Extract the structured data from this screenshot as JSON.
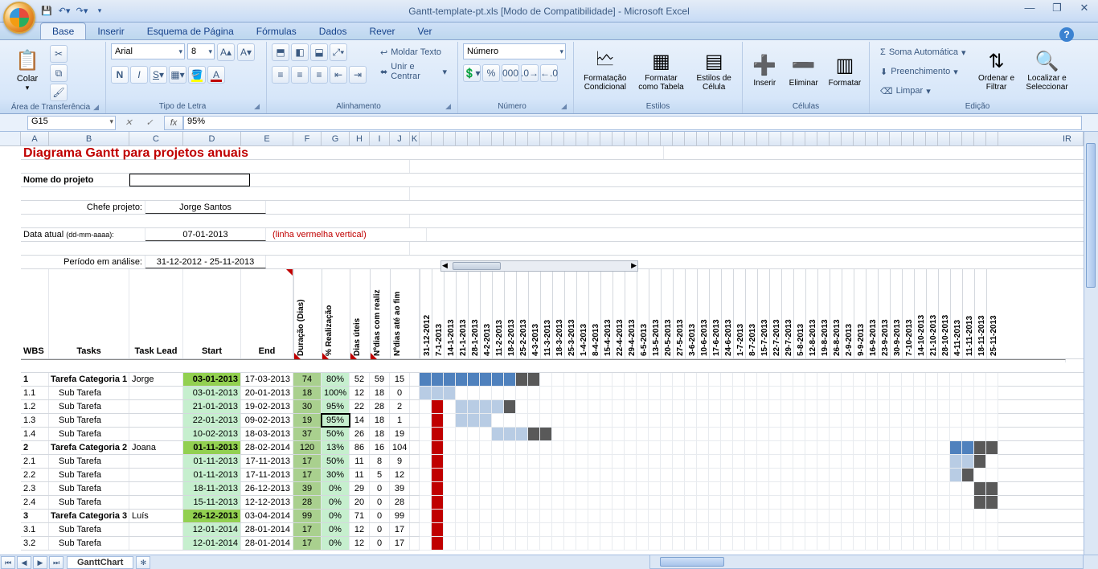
{
  "app": {
    "title": "Gantt-template-pt.xls  [Modo de Compatibilidade] - Microsoft Excel"
  },
  "qat": {
    "save": "save-icon",
    "undo": "undo-icon",
    "redo": "redo-icon"
  },
  "tabs": [
    "Base",
    "Inserir",
    "Esquema de Página",
    "Fórmulas",
    "Dados",
    "Rever",
    "Ver"
  ],
  "ribbon": {
    "clipboard": {
      "paste": "Colar",
      "label": "Área de Transferência"
    },
    "font": {
      "name": "Arial",
      "size": "8",
      "label": "Tipo de Letra"
    },
    "alignment": {
      "wrap": "Moldar Texto",
      "merge": "Unir e Centrar",
      "label": "Alinhamento"
    },
    "number": {
      "format": "Número",
      "label": "Número"
    },
    "styles": {
      "cond": "Formatação Condicional",
      "table": "Formatar como Tabela",
      "cell": "Estilos de Célula",
      "label": "Estilos"
    },
    "cells": {
      "insert": "Inserir",
      "delete": "Eliminar",
      "format": "Formatar",
      "label": "Células"
    },
    "editing": {
      "sum": "Soma Automática",
      "fill": "Preenchimento",
      "clear": "Limpar",
      "sort": "Ordenar e Filtrar",
      "find": "Localizar e Seleccionar",
      "label": "Edição"
    }
  },
  "namebox": "G15",
  "formula": "95%",
  "colHeaders": [
    "A",
    "B",
    "C",
    "D",
    "E",
    "F",
    "G",
    "H",
    "I",
    "J",
    "K"
  ],
  "lastCol": "IR",
  "content": {
    "title": "Diagrama Gantt para projetos anuais",
    "projLabel": "Nome do projeto",
    "pmLabel": "Chefe projeto:",
    "pmName": "Jorge Santos",
    "dateLabel": "Data atual",
    "dateFmt": "(dd-mm-aaaa):",
    "dateVal": "07-01-2013",
    "dateHint": "(linha vermelha vertical)",
    "periodLabel": "Período em análise:",
    "periodVal": "31-12-2012 - 25-11-2013",
    "hdr": {
      "wbs": "WBS",
      "tasks": "Tasks",
      "lead": "Task Lead",
      "start": "Start",
      "end": "End",
      "dur": "Duração (Dias)",
      "pct": "% Realização",
      "util": "Dias úteis",
      "real": "Nºdias com realiz",
      "fim": "Nºdias até ao fim"
    },
    "dates": [
      "31-12-2012",
      "7-1-2013",
      "14-1-2013",
      "21-1-2013",
      "28-1-2013",
      "4-2-2013",
      "11-2-2013",
      "18-2-2013",
      "25-2-2013",
      "4-3-2013",
      "11-3-2013",
      "18-3-2013",
      "25-3-2013",
      "1-4-2013",
      "8-4-2013",
      "15-4-2013",
      "22-4-2013",
      "29-4-2013",
      "6-5-2013",
      "13-5-2013",
      "20-5-2013",
      "27-5-2013",
      "3-6-2013",
      "10-6-2013",
      "17-6-2013",
      "24-6-2013",
      "1-7-2013",
      "8-7-2013",
      "15-7-2013",
      "22-7-2013",
      "29-7-2013",
      "5-8-2013",
      "12-8-2013",
      "19-8-2013",
      "26-8-2013",
      "2-9-2013",
      "9-9-2013",
      "16-9-2013",
      "23-9-2013",
      "30-9-2013",
      "7-10-2013",
      "14-10-2013",
      "21-10-2013",
      "28-10-2013",
      "4-11-2013",
      "11-11-2013",
      "18-11-2013",
      "25-11-2013"
    ]
  },
  "rows": [
    {
      "r": 12,
      "wbs": "1",
      "task": "Tarefa Categoria 1",
      "lead": "Jorge",
      "start": "03-01-2013",
      "end": "17-03-2013",
      "dur": "74",
      "pct": "80%",
      "u": "52",
      "nr": "59",
      "nf": "15",
      "cat": true,
      "bar": {
        "from": 0,
        "blue": 8,
        "dark": 2
      }
    },
    {
      "r": 13,
      "wbs": "1.1",
      "task": "Sub Tarefa",
      "lead": "",
      "start": "03-01-2013",
      "end": "20-01-2013",
      "dur": "18",
      "pct": "100%",
      "u": "12",
      "nr": "18",
      "nf": "0",
      "bar": {
        "from": 0,
        "light": 3
      }
    },
    {
      "r": 14,
      "wbs": "1.2",
      "task": "Sub Tarefa",
      "lead": "",
      "start": "21-01-2013",
      "end": "19-02-2013",
      "dur": "30",
      "pct": "95%",
      "u": "22",
      "nr": "28",
      "nf": "2",
      "bar": {
        "from": 3,
        "light": 4,
        "dark": 1
      }
    },
    {
      "r": 15,
      "wbs": "1.3",
      "task": "Sub Tarefa",
      "lead": "",
      "start": "22-01-2013",
      "end": "09-02-2013",
      "dur": "19",
      "pct": "95%",
      "u": "14",
      "nr": "18",
      "nf": "1",
      "sel": true,
      "bar": {
        "from": 3,
        "light": 3
      }
    },
    {
      "r": 16,
      "wbs": "1.4",
      "task": "Sub Tarefa",
      "lead": "",
      "start": "10-02-2013",
      "end": "18-03-2013",
      "dur": "37",
      "pct": "50%",
      "u": "26",
      "nr": "18",
      "nf": "19",
      "bar": {
        "from": 6,
        "light": 3,
        "dark": 2
      }
    },
    {
      "r": 17,
      "wbs": "2",
      "task": "Tarefa Categoria 2",
      "lead": "Joana",
      "start": "01-11-2013",
      "end": "28-02-2014",
      "dur": "120",
      "pct": "13%",
      "u": "86",
      "nr": "16",
      "nf": "104",
      "cat": true,
      "bar": {
        "from": 44,
        "blue": 2,
        "dark": 2
      }
    },
    {
      "r": 18,
      "wbs": "2.1",
      "task": "Sub Tarefa",
      "lead": "",
      "start": "01-11-2013",
      "end": "17-11-2013",
      "dur": "17",
      "pct": "50%",
      "u": "11",
      "nr": "8",
      "nf": "9",
      "bar": {
        "from": 44,
        "light": 2,
        "dark": 1
      }
    },
    {
      "r": 19,
      "wbs": "2.2",
      "task": "Sub Tarefa",
      "lead": "",
      "start": "01-11-2013",
      "end": "17-11-2013",
      "dur": "17",
      "pct": "30%",
      "u": "11",
      "nr": "5",
      "nf": "12",
      "bar": {
        "from": 44,
        "light": 1,
        "dark": 1
      }
    },
    {
      "r": 20,
      "wbs": "2.3",
      "task": "Sub Tarefa",
      "lead": "",
      "start": "18-11-2013",
      "end": "26-12-2013",
      "dur": "39",
      "pct": "0%",
      "u": "29",
      "nr": "0",
      "nf": "39",
      "bar": {
        "from": 46,
        "dark": 2
      }
    },
    {
      "r": 21,
      "wbs": "2.4",
      "task": "Sub Tarefa",
      "lead": "",
      "start": "15-11-2013",
      "end": "12-12-2013",
      "dur": "28",
      "pct": "0%",
      "u": "20",
      "nr": "0",
      "nf": "28",
      "bar": {
        "from": 46,
        "dark": 2
      }
    },
    {
      "r": 22,
      "wbs": "3",
      "task": "Tarefa Categoria 3",
      "lead": "Luís",
      "start": "26-12-2013",
      "end": "03-04-2014",
      "dur": "99",
      "pct": "0%",
      "u": "71",
      "nr": "0",
      "nf": "99",
      "cat": true
    },
    {
      "r": 23,
      "wbs": "3.1",
      "task": "Sub Tarefa",
      "lead": "",
      "start": "12-01-2014",
      "end": "28-01-2014",
      "dur": "17",
      "pct": "0%",
      "u": "12",
      "nr": "0",
      "nf": "17"
    },
    {
      "r": 24,
      "wbs": "3.2",
      "task": "Sub Tarefa",
      "lead": "",
      "start": "12-01-2014",
      "end": "28-01-2014",
      "dur": "17",
      "pct": "0%",
      "u": "12",
      "nr": "0",
      "nf": "17"
    }
  ],
  "sheetTab": "GanttChart"
}
